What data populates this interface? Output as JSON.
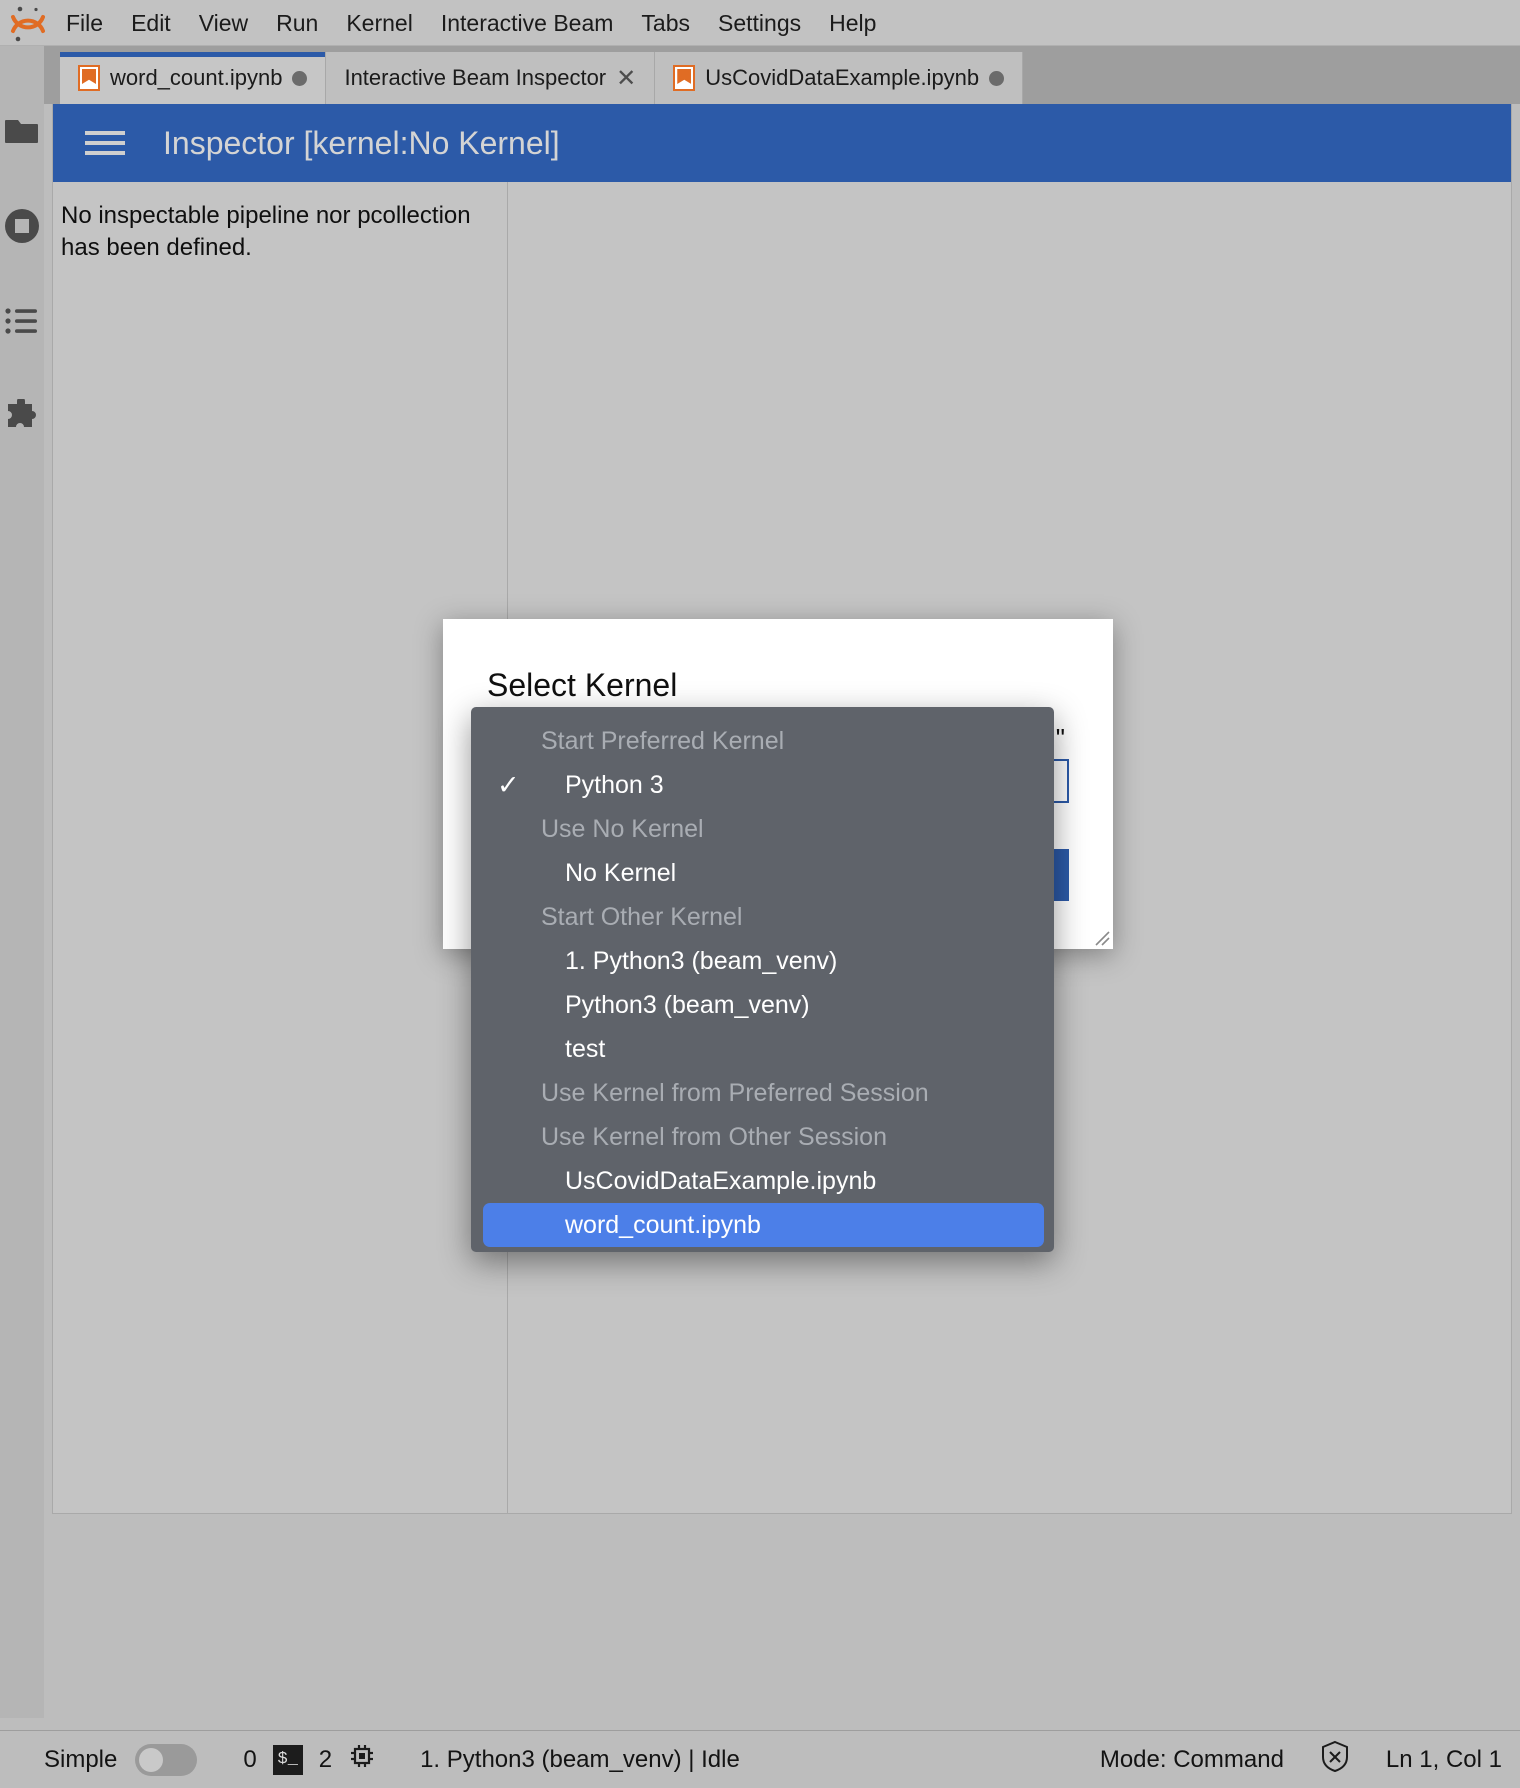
{
  "app": {
    "logo_name": "jupyter-logo"
  },
  "menubar": {
    "items": [
      {
        "label": "File",
        "name": "menu-file"
      },
      {
        "label": "Edit",
        "name": "menu-edit"
      },
      {
        "label": "View",
        "name": "menu-view"
      },
      {
        "label": "Run",
        "name": "menu-run"
      },
      {
        "label": "Kernel",
        "name": "menu-kernel"
      },
      {
        "label": "Interactive Beam",
        "name": "menu-interactive-beam"
      },
      {
        "label": "Tabs",
        "name": "menu-tabs"
      },
      {
        "label": "Settings",
        "name": "menu-settings"
      },
      {
        "label": "Help",
        "name": "menu-help"
      }
    ]
  },
  "activitybar": {
    "items": [
      {
        "icon": "folder-icon",
        "name": "sidebar-item-file-browser"
      },
      {
        "icon": "stop-circle-icon",
        "name": "sidebar-item-running-sessions"
      },
      {
        "icon": "list-icon",
        "name": "sidebar-item-commands"
      },
      {
        "icon": "puzzle-icon",
        "name": "sidebar-item-extensions"
      }
    ]
  },
  "tabs": [
    {
      "label": "word_count.ipynb",
      "state": "current",
      "dirty": true,
      "closable": false
    },
    {
      "label": "Interactive Beam Inspector",
      "state": "inactive",
      "dirty": false,
      "closable": true
    },
    {
      "label": "UsCovidDataExample.ipynb",
      "state": "inactive",
      "dirty": true,
      "closable": false
    }
  ],
  "inspector": {
    "title": "Inspector [kernel:No Kernel]",
    "message": "No inspectable pipeline nor pcollection has been defined."
  },
  "dialog": {
    "title": "Select Kernel",
    "quote_fragment": "\""
  },
  "kernel_menu": {
    "rows": [
      {
        "type": "header",
        "label": "Start Preferred Kernel",
        "checked": false,
        "selected": false
      },
      {
        "type": "option",
        "label": "Python 3",
        "checked": true,
        "selected": false
      },
      {
        "type": "header",
        "label": "Use No Kernel",
        "checked": false,
        "selected": false
      },
      {
        "type": "option",
        "label": "No Kernel",
        "checked": false,
        "selected": false
      },
      {
        "type": "header",
        "label": "Start Other Kernel",
        "checked": false,
        "selected": false
      },
      {
        "type": "option",
        "label": "1. Python3 (beam_venv)",
        "checked": false,
        "selected": false
      },
      {
        "type": "option",
        "label": "Python3 (beam_venv)",
        "checked": false,
        "selected": false
      },
      {
        "type": "option",
        "label": "test",
        "checked": false,
        "selected": false
      },
      {
        "type": "header",
        "label": "Use Kernel from Preferred Session",
        "checked": false,
        "selected": false
      },
      {
        "type": "header",
        "label": "Use Kernel from Other Session",
        "checked": false,
        "selected": false
      },
      {
        "type": "option",
        "label": "UsCovidDataExample.ipynb",
        "checked": false,
        "selected": false
      },
      {
        "type": "option",
        "label": "word_count.ipynb",
        "checked": false,
        "selected": true
      }
    ],
    "check_glyph": "✓",
    "selected_color": "#4c7fe8"
  },
  "statusbar": {
    "simple_label": "Simple",
    "simple_on": false,
    "terminals_count": "0",
    "terminal_glyph": "$_",
    "kernels_count": "2",
    "kernel_icon": "cpu-icon",
    "kernel_status": "1. Python3 (beam_venv) | Idle",
    "mode": "Mode: Command",
    "shield_icon": "shield-off-icon",
    "cursor_position": "Ln 1, Col 1"
  },
  "colors": {
    "accent": "#2c5aa8",
    "chrome": "#c2c2c2",
    "menu_bg": "#5f636a",
    "highlight": "#4c7fe8",
    "notebook_orange": "#e06c24"
  }
}
